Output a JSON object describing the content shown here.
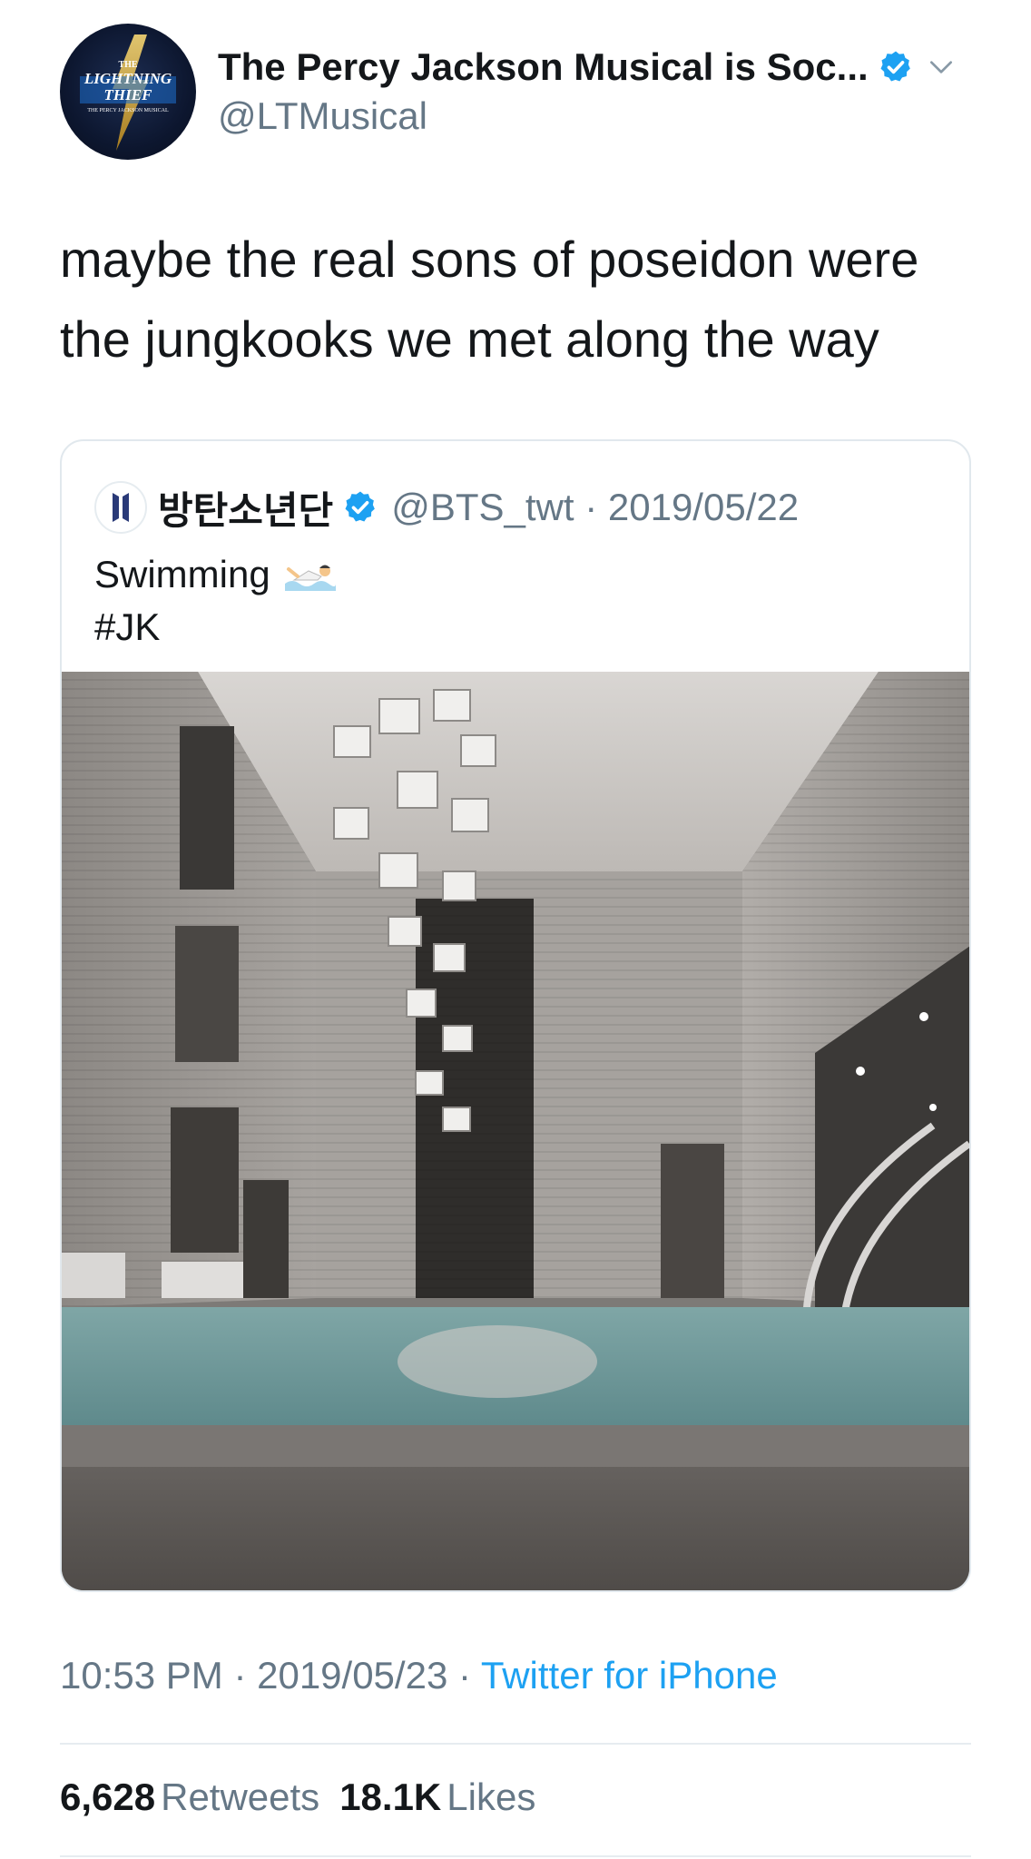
{
  "tweet": {
    "author": {
      "display_name": "The Percy Jackson Musical is Soc...",
      "handle": "@LTMusical",
      "verified": true,
      "avatar_logo_text": [
        "THE",
        "LIGHTNING",
        "THIEF",
        "THE PERCY JACKSON MUSICAL"
      ]
    },
    "text_line1": "maybe the real sons of poseidon were",
    "text_line2": "the jungkooks we met along the way",
    "quoted": {
      "display_name": "방탄소년단",
      "handle_date": "@BTS_twt · 2019/05/22",
      "verified": true,
      "text_line1": "Swimming",
      "text_line2": "#JK",
      "emoji_icon": "person-swimming-icon"
    },
    "meta": {
      "time_date": "10:53 PM · 2019/05/23 · ",
      "source": "Twitter for iPhone"
    },
    "stats": {
      "retweets_count": "6,628",
      "retweets_label": "Retweets",
      "likes_count": "18.1K",
      "likes_label": "Likes"
    }
  },
  "colors": {
    "accent": "#1da1f2",
    "secondary_text": "#657786",
    "primary_text": "#14171a",
    "border": "#e1e8ed"
  }
}
